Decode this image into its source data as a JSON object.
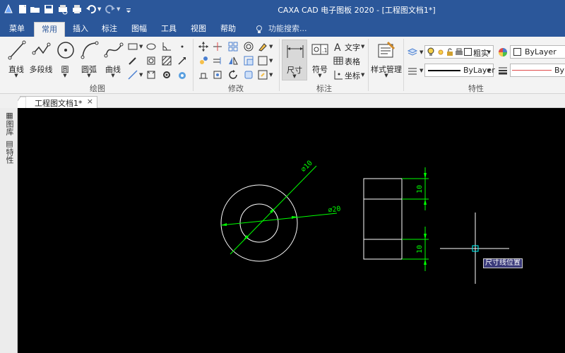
{
  "titlebar": {
    "title": "CAXA CAD 电子图板 2020 - [工程图文档1*]",
    "quick_access": [
      "logo-icon",
      "new-icon",
      "open-icon",
      "save-icon",
      "print-preview-icon",
      "print-icon",
      "undo-icon",
      "redo-icon",
      "customize-icon"
    ]
  },
  "tabs": {
    "items": [
      "菜单",
      "常用",
      "插入",
      "标注",
      "图幅",
      "工具",
      "视图",
      "帮助"
    ],
    "active": "常用",
    "search_placeholder": "功能搜索..."
  },
  "ribbon": {
    "draw": {
      "label": "绘图",
      "buttons": [
        "直线",
        "多段线",
        "圆",
        "圆弧",
        "曲线"
      ]
    },
    "modify": {
      "label": "修改"
    },
    "annotate": {
      "label": "标注",
      "dimension": "尺寸",
      "symbol": "符号",
      "text": "文字",
      "table": "表格",
      "coordinate": "坐标"
    },
    "style": {
      "label": "样式管理"
    },
    "properties": {
      "label": "特性",
      "layer": "粗实",
      "color": "ByLayer",
      "linetype": "ByLayer",
      "lineweight": "ByLa"
    }
  },
  "document": {
    "tab_title": "工程图文档1*",
    "close": "×"
  },
  "leftdock": {
    "items": [
      "图库",
      "特性"
    ]
  },
  "drawing": {
    "colors": {
      "geometry": "#ffffff",
      "dimension": "#00ff00",
      "cursor": "#ffffff",
      "snapbox": "#00ffff"
    },
    "dim_inner": "⌀10",
    "dim_outer": "⌀20",
    "dim_top": "10",
    "dim_bottom": "10",
    "tooltip": "尺寸线位置"
  }
}
